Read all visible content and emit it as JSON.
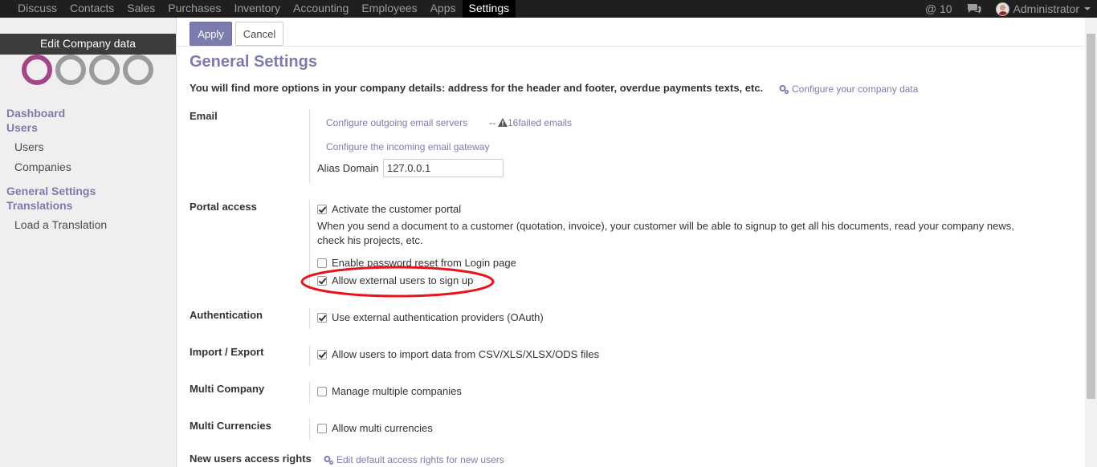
{
  "topbar": {
    "menu": [
      "Discuss",
      "Contacts",
      "Sales",
      "Purchases",
      "Inventory",
      "Accounting",
      "Employees",
      "Apps",
      "Settings"
    ],
    "active": "Settings",
    "mentions_count": "10",
    "user_name": "Administrator"
  },
  "sidebar": {
    "edit_company": "Edit Company data",
    "dashboard": "Dashboard",
    "users_head": "Users",
    "users_item": "Users",
    "companies_item": "Companies",
    "general_settings": "General Settings",
    "translations_head": "Translations",
    "load_translation": "Load a Translation"
  },
  "control_panel": {
    "apply": "Apply",
    "cancel": "Cancel"
  },
  "page": {
    "title": "General Settings",
    "intro": "You will find more options in your company details: address for the header and footer, overdue payments texts, etc.",
    "configure_company_link": "Configure your company data"
  },
  "email": {
    "label": "Email",
    "outgoing_link": "Configure outgoing email servers",
    "dash": "--",
    "failed": "16failed emails",
    "incoming_link": "Configure the incoming email gateway",
    "alias_label": "Alias Domain",
    "alias_value": "127.0.0.1"
  },
  "portal": {
    "label": "Portal access",
    "activate": "Activate the customer portal",
    "activate_checked": true,
    "description": "When you send a document to a customer (quotation, invoice), your customer will be able to signup to get all his documents, read your company news, check his projects, etc.",
    "password_reset": "Enable password reset from Login page",
    "password_reset_checked": false,
    "external_signup": "Allow external users to sign up",
    "external_signup_checked": true
  },
  "authentication": {
    "label": "Authentication",
    "oauth": "Use external authentication providers (OAuth)",
    "checked": true
  },
  "import_export": {
    "label": "Import / Export",
    "option": "Allow users to import data from CSV/XLS/XLSX/ODS files",
    "checked": true
  },
  "multi_company": {
    "label": "Multi Company",
    "option": "Manage multiple companies",
    "checked": false
  },
  "multi_currencies": {
    "label": "Multi Currencies",
    "option": "Allow multi currencies",
    "checked": false
  },
  "new_users": {
    "label": "New users access rights",
    "link": "Edit default access rights for new users"
  },
  "colors": {
    "brand": "#7c7bad",
    "annotation": "#e8141c",
    "topbar": "#1f1f1f"
  }
}
